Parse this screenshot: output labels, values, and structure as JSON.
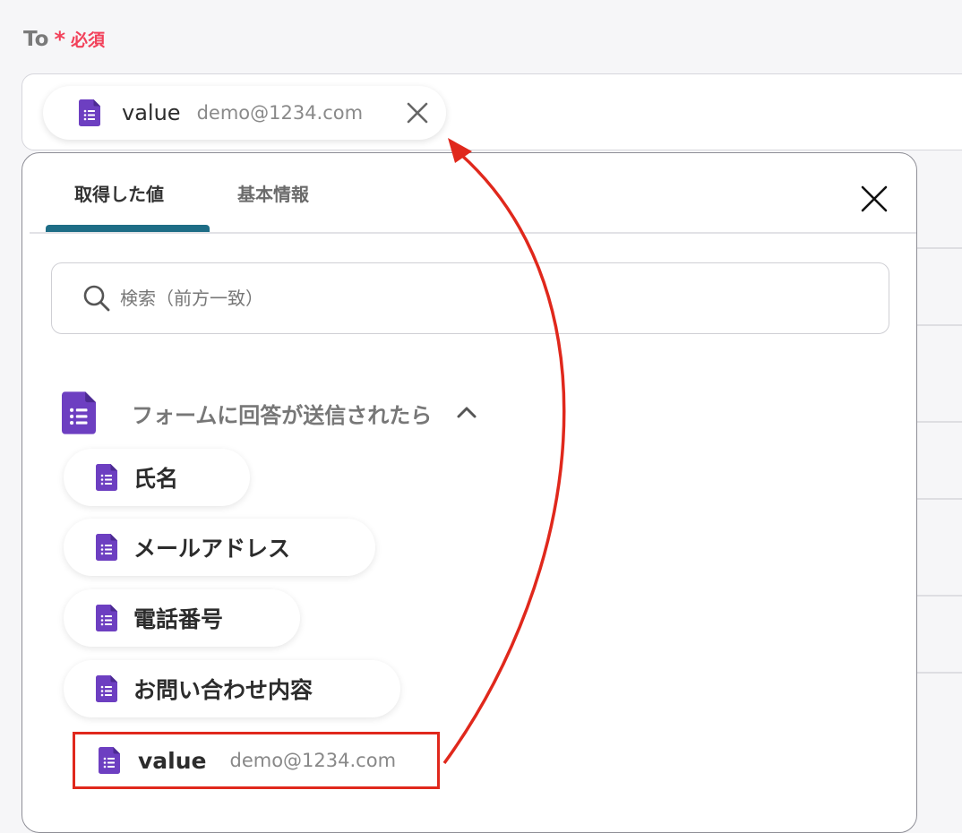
{
  "field": {
    "label": "To",
    "required_star": "*",
    "required_text": "必須"
  },
  "chip": {
    "icon": "google-forms-icon",
    "name": "value",
    "value": "demo@1234.com",
    "close_icon": "close-icon"
  },
  "panel": {
    "tabs": [
      {
        "label": "取得した値",
        "active": true
      },
      {
        "label": "基本情報",
        "active": false
      }
    ],
    "close_icon": "close-icon",
    "search": {
      "placeholder": "検索（前方一致）",
      "value": ""
    },
    "group": {
      "icon": "google-forms-icon",
      "title": "フォームに回答が送信されたら",
      "expanded": true
    },
    "items": [
      {
        "label": "氏名"
      },
      {
        "label": "メールアドレス"
      },
      {
        "label": "電話番号"
      },
      {
        "label": "お問い合わせ内容"
      }
    ],
    "selected_item": {
      "name": "value",
      "value": "demo@1234.com"
    }
  },
  "colors": {
    "required": "#f2415a",
    "tab_underline": "#1e6d86",
    "forms_purple": "#6d3fc1",
    "annotation_red": "#e0281c"
  }
}
